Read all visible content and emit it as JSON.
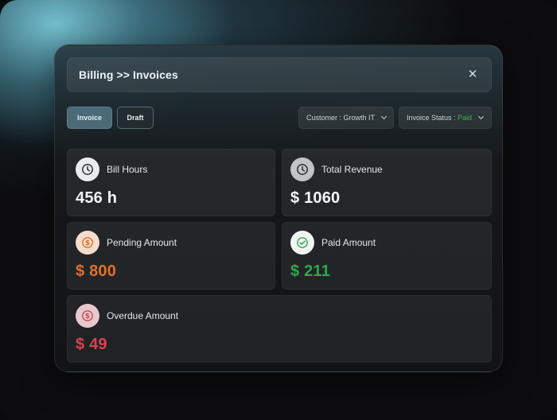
{
  "header": {
    "title": "Billing >> Invoices",
    "close_symbol": "✕"
  },
  "tabs": [
    {
      "label": "Invoice",
      "active": true
    },
    {
      "label": "Draft",
      "active": false
    }
  ],
  "filters": {
    "customer": {
      "label": "Customer : Growth IT"
    },
    "status": {
      "label_prefix": "Invoice Status : ",
      "value": "Paid"
    }
  },
  "cards": {
    "bill_hours": {
      "label": "Bill Hours",
      "value": "456 h",
      "icon": "clock-icon"
    },
    "total_revenue": {
      "label": "Total Revenue",
      "value": "$ 1060",
      "icon": "clock-icon"
    },
    "pending": {
      "label": "Pending Amount",
      "value": "$ 800",
      "icon": "dollar-coin-icon",
      "color": "#e0702a"
    },
    "paid": {
      "label": "Paid Amount",
      "value": "$ 211",
      "icon": "check-circle-icon",
      "color": "#2fa84a"
    },
    "overdue": {
      "label": "Overdue Amount",
      "value": "$ 49",
      "icon": "dollar-coin-icon",
      "color": "#d9424f"
    }
  }
}
